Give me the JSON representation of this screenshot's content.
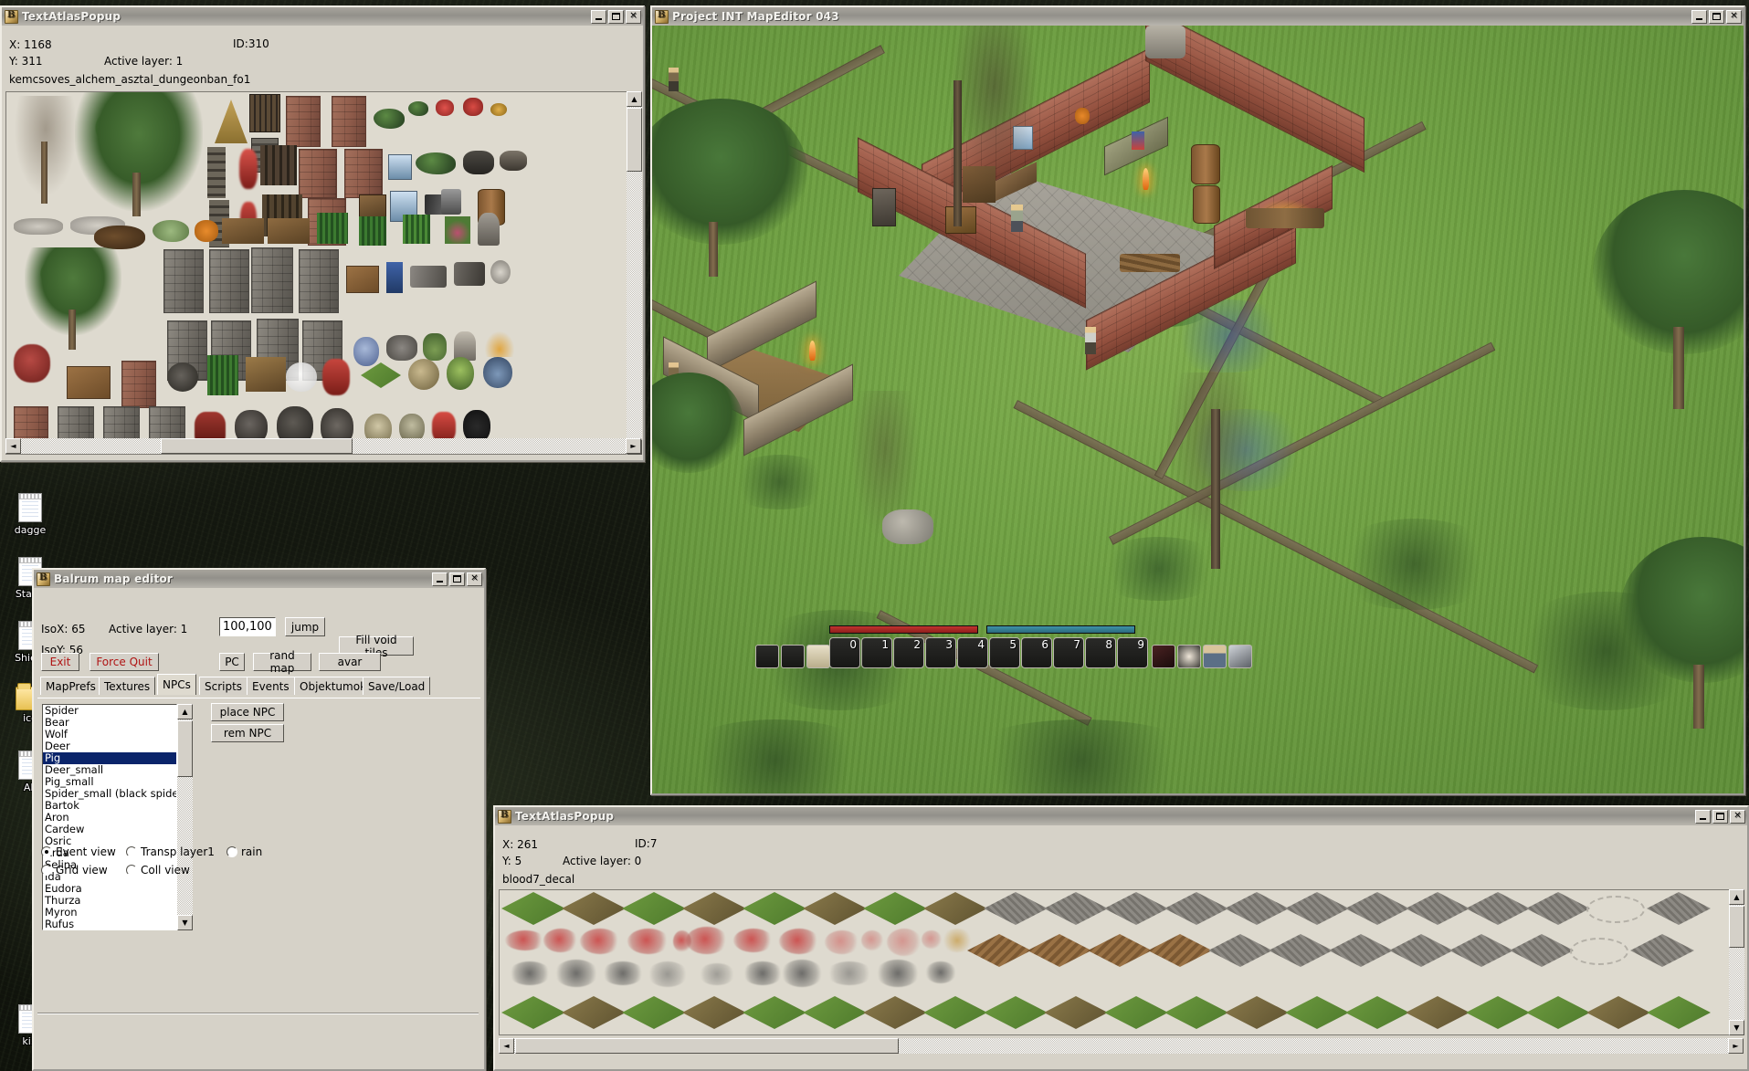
{
  "desktop": {
    "icons": [
      {
        "label": "dagge",
        "type": "text-file-icon"
      },
      {
        "label": "Staffo",
        "type": "text-file-icon"
      },
      {
        "label": "Shield",
        "type": "text-file-icon"
      },
      {
        "label": "ico",
        "type": "folder-icon"
      },
      {
        "label": "AI.",
        "type": "text-file-icon"
      },
      {
        "label": "ki.t",
        "type": "text-file-icon"
      }
    ]
  },
  "atlas_popup_top": {
    "title": "TextAtlasPopup",
    "x_label": "X: 1168",
    "y_label": "Y: 311",
    "id_label": "ID:310",
    "active_layer_label": "Active layer: 1",
    "asset_name": "kemcsoves_alchem_asztal_dungeonban_fo1",
    "window_buttons": {
      "minimize": "_",
      "maximize": "□",
      "close": "✕"
    }
  },
  "map_editor": {
    "title": "Project INT MapEditor 043",
    "window_buttons": {
      "minimize": "_",
      "maximize": "□",
      "close": "✕"
    },
    "hud": {
      "health_bar_color": "#a82a26",
      "mana_bar_color": "#3a86a0",
      "hotbar_slots": [
        "0",
        "1",
        "2",
        "3",
        "4",
        "5",
        "6",
        "7",
        "8",
        "9"
      ],
      "left_slots": [
        "",
        "",
        "",
        ""
      ],
      "right_icons": [
        "spell-icon",
        "eye-icon",
        "character-icon",
        "book-icon"
      ]
    }
  },
  "balrum": {
    "title": "Balrum map editor",
    "window_buttons": {
      "minimize": "_",
      "maximize": "□",
      "close": "✕"
    },
    "iso_x_label": "IsoX: 65",
    "iso_y_label": "IsoY: 56",
    "active_layer_label": "Active layer: 1",
    "jump_field_value": "100,100",
    "buttons": {
      "jump": "jump",
      "fill_void_tiles": "Fill void tiles",
      "exit": "Exit",
      "force_quit": "Force Quit",
      "pc": "PC",
      "rand_map": "rand map",
      "avar": "avar",
      "place_npc": "place NPC",
      "rem_npc": "rem NPC"
    },
    "tabs": [
      {
        "label": "MapPrefs",
        "active": false
      },
      {
        "label": "Textures",
        "active": false
      },
      {
        "label": "NPCs",
        "active": true
      },
      {
        "label": "Scripts",
        "active": false
      },
      {
        "label": "Events",
        "active": false
      },
      {
        "label": "Objektumok",
        "active": false
      },
      {
        "label": "Save/Load",
        "active": false
      }
    ],
    "npc_list": [
      "Spider",
      "Bear",
      "Wolf",
      "Deer",
      "Pig",
      "Deer_small",
      "Pig_small",
      "Spider_small (black spider)",
      "Bartok",
      "Aron",
      "Cardew",
      "Osric",
      "Arda",
      "Selina",
      "Ida",
      "Eudora",
      "Thurza",
      "Myron",
      "Rufus"
    ],
    "npc_selected": "Pig",
    "view_options": [
      {
        "label": "Event view",
        "checked": true
      },
      {
        "label": "Transp layer1",
        "checked": false
      },
      {
        "label": "rain",
        "checked": false
      },
      {
        "label": "Grid view",
        "checked": false
      },
      {
        "label": "Coll view",
        "checked": false
      }
    ]
  },
  "atlas_popup_bottom": {
    "title": "TextAtlasPopup",
    "x_label": "X: 261",
    "y_label": "Y: 5",
    "id_label": "ID:7",
    "active_layer_label": "Active layer: 0",
    "asset_name": "blood7_decal",
    "window_buttons": {
      "minimize": "_",
      "maximize": "□",
      "close": "✕"
    }
  },
  "scrollbar": {
    "left_arrow": "◄",
    "right_arrow": "►",
    "up_arrow": "▲",
    "down_arrow": "▼"
  }
}
